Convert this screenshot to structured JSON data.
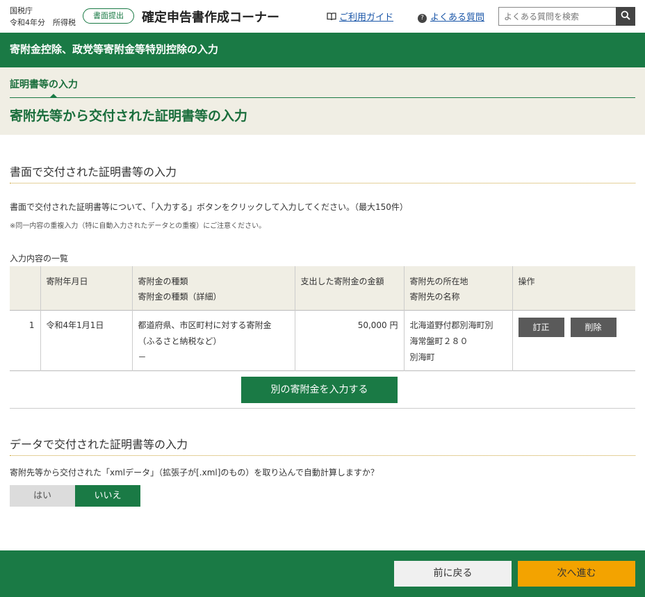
{
  "header": {
    "agency": "国税庁",
    "year_tax": "令和4年分　所得税",
    "paper_badge": "書面提出",
    "corner_title": "確定申告書作成コーナー",
    "guide_link": "ご利用ガイド",
    "faq_link": "よくある質問",
    "search_placeholder": "よくある質問を検索"
  },
  "band_title": "寄附金控除、政党等寄附金等特別控除の入力",
  "step": {
    "label": "証明書等の入力",
    "page_title": "寄附先等から交付された証明書等の入力"
  },
  "paper_section": {
    "heading": "書面で交付された証明書等の入力",
    "instruction": "書面で交付された証明書等について、「入力する」ボタンをクリックして入力してください。（最大150件）",
    "note": "※同一内容の重複入力（特に自動入力されたデータとの重複）にご注意ください。",
    "list_caption": "入力内容の一覧",
    "columns": {
      "date": "寄附年月日",
      "type": "寄附金の種類",
      "type_detail": "寄附金の種類（詳細）",
      "amount": "支出した寄附金の金額",
      "address": "寄附先の所在地",
      "name": "寄附先の名称",
      "ops": "操作"
    },
    "rows": [
      {
        "no": "1",
        "date": "令和4年1月1日",
        "type": "都道府県、市区町村に対する寄附金",
        "type_sub": "（ふるさと納税など）",
        "type_detail": "－",
        "amount": "50,000 円",
        "address_1": "北海道野付郡別海町別",
        "address_2": "海常盤町２８０",
        "name": "別海町",
        "edit_label": "訂正",
        "delete_label": "削除"
      }
    ],
    "add_button": "別の寄附金を入力する"
  },
  "data_section": {
    "heading": "データで交付された証明書等の入力",
    "question": "寄附先等から交付された「xmlデータ」（拡張子が[.xml]のもの）を取り込んで自動計算しますか？",
    "yes_label": "はい",
    "no_label": "いいえ",
    "selected": "いいえ"
  },
  "footer": {
    "back_label": "前に戻る",
    "next_label": "次へ進む"
  },
  "colors": {
    "brand_green": "#1a7a45",
    "beige": "#f0eee4",
    "next_orange": "#f3a300"
  }
}
